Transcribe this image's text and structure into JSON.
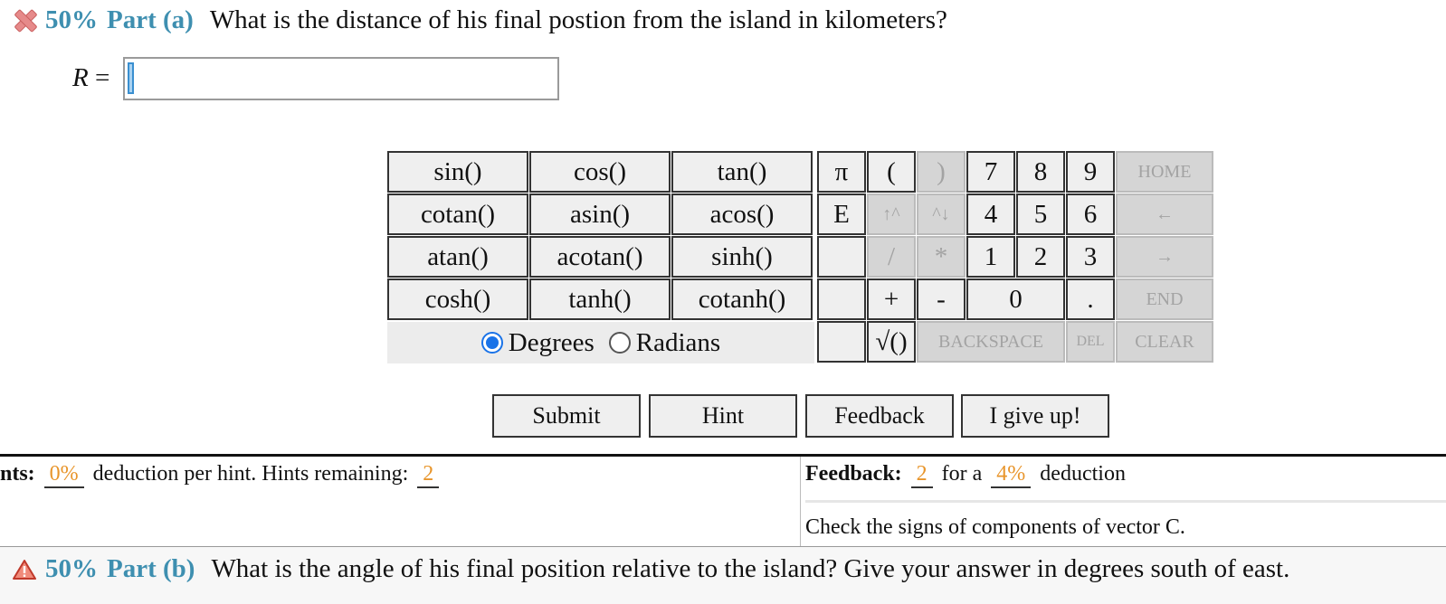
{
  "part_a": {
    "percent": "50%",
    "label": "Part (a)",
    "question": "What is the distance of his final postion from the island in kilometers?",
    "status_icon": "x-mark-icon"
  },
  "answer": {
    "variable": "R",
    "equals": "=",
    "value": ""
  },
  "keypad": {
    "functions": [
      "sin()",
      "cos()",
      "tan()",
      "cotan()",
      "asin()",
      "acos()",
      "atan()",
      "acotan()",
      "sinh()",
      "cosh()",
      "tanh()",
      "cotanh()"
    ],
    "constants": {
      "pi": "π",
      "e": "E"
    },
    "ops": {
      "open_paren": "(",
      "close_paren": ")",
      "up": "↑^",
      "down": "^↓",
      "divide": "/",
      "multiply": "*",
      "plus": "+",
      "minus": "-",
      "sqrt": "√()",
      "dot": "."
    },
    "digits": {
      "d7": "7",
      "d8": "8",
      "d9": "9",
      "d4": "4",
      "d5": "5",
      "d6": "6",
      "d1": "1",
      "d2": "2",
      "d3": "3",
      "d0": "0"
    },
    "controls": {
      "home": "HOME",
      "left": "←",
      "right": "→",
      "end": "END",
      "backspace": "BACKSPACE",
      "del": "DEL",
      "clear": "CLEAR"
    },
    "angle_mode": {
      "degrees": "Degrees",
      "radians": "Radians",
      "selected": "Degrees"
    }
  },
  "actions": {
    "submit": "Submit",
    "hint": "Hint",
    "feedback": "Feedback",
    "give_up": "I give up!"
  },
  "hints": {
    "label": "nts:",
    "deduction": "0%",
    "text1": "deduction per hint. Hints remaining:",
    "remaining": "2"
  },
  "feedback": {
    "label": "Feedback:",
    "count": "2",
    "text1": "for a",
    "deduction": "4%",
    "text2": "deduction",
    "message": "Check the signs of components of vector C."
  },
  "part_b": {
    "percent": "50%",
    "label": "Part (b)",
    "question": "What is the angle of his final position relative to the island? Give your answer in degrees south of east.",
    "status_icon": "warning-icon"
  },
  "colors": {
    "accent": "#3e8fb0",
    "value": "#e8952b",
    "radio": "#1a73e8"
  }
}
